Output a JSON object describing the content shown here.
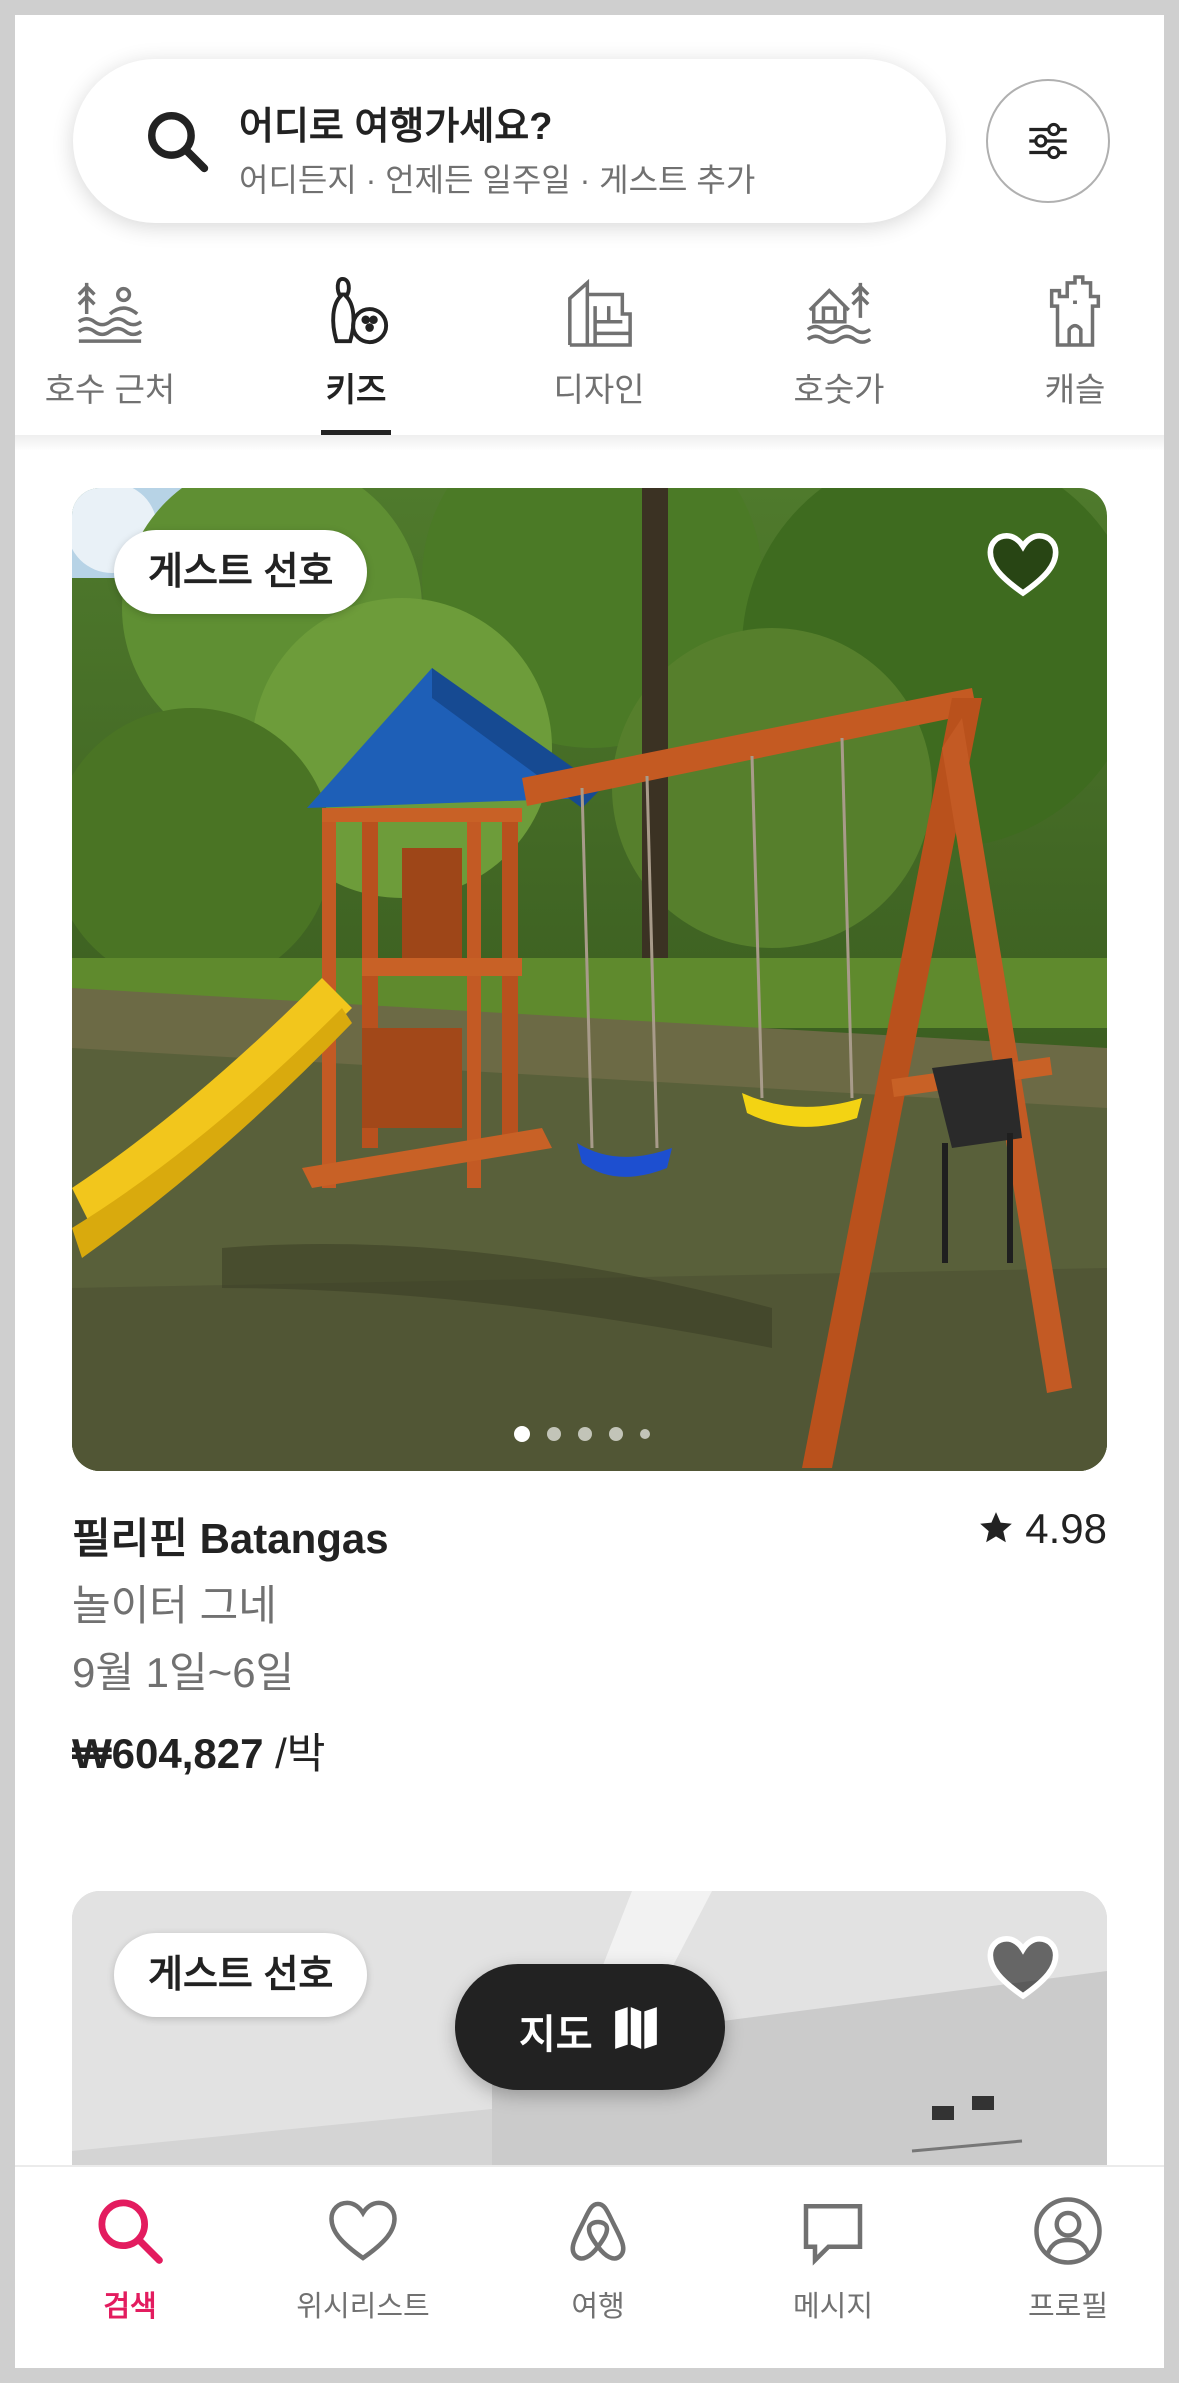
{
  "search": {
    "title": "어디로 여행가세요?",
    "subtitle": "어디든지 · 언제든 일주일 · 게스트 추가"
  },
  "categories": [
    {
      "label": "호수 근처",
      "icon": "lake-icon",
      "active": false
    },
    {
      "label": "키즈",
      "icon": "kids-bowling-icon",
      "active": true
    },
    {
      "label": "디자인",
      "icon": "design-building-icon",
      "active": false
    },
    {
      "label": "호숫가",
      "icon": "lakefront-house-icon",
      "active": false
    },
    {
      "label": "캐슬",
      "icon": "castle-icon",
      "active": false
    }
  ],
  "listing1": {
    "badge": "게스트 선호",
    "title": "필리핀 Batangas",
    "rating": "4.98",
    "subtitle": "놀이터 그네",
    "dates": "9월 1일~6일",
    "price": "₩604,827",
    "price_unit": " /박",
    "photo_count": 5,
    "active_photo": 1
  },
  "listing2": {
    "badge": "게스트 선호"
  },
  "map_button": {
    "label": "지도"
  },
  "tabs": [
    {
      "label": "검색",
      "icon": "search-icon",
      "active": true
    },
    {
      "label": "위시리스트",
      "icon": "heart-icon",
      "active": false
    },
    {
      "label": "여행",
      "icon": "airbnb-logo-icon",
      "active": false
    },
    {
      "label": "메시지",
      "icon": "message-icon",
      "active": false
    },
    {
      "label": "프로필",
      "icon": "profile-icon",
      "active": false
    }
  ],
  "colors": {
    "accent": "#e31c5f",
    "text": "#222222",
    "muted": "#717171"
  }
}
